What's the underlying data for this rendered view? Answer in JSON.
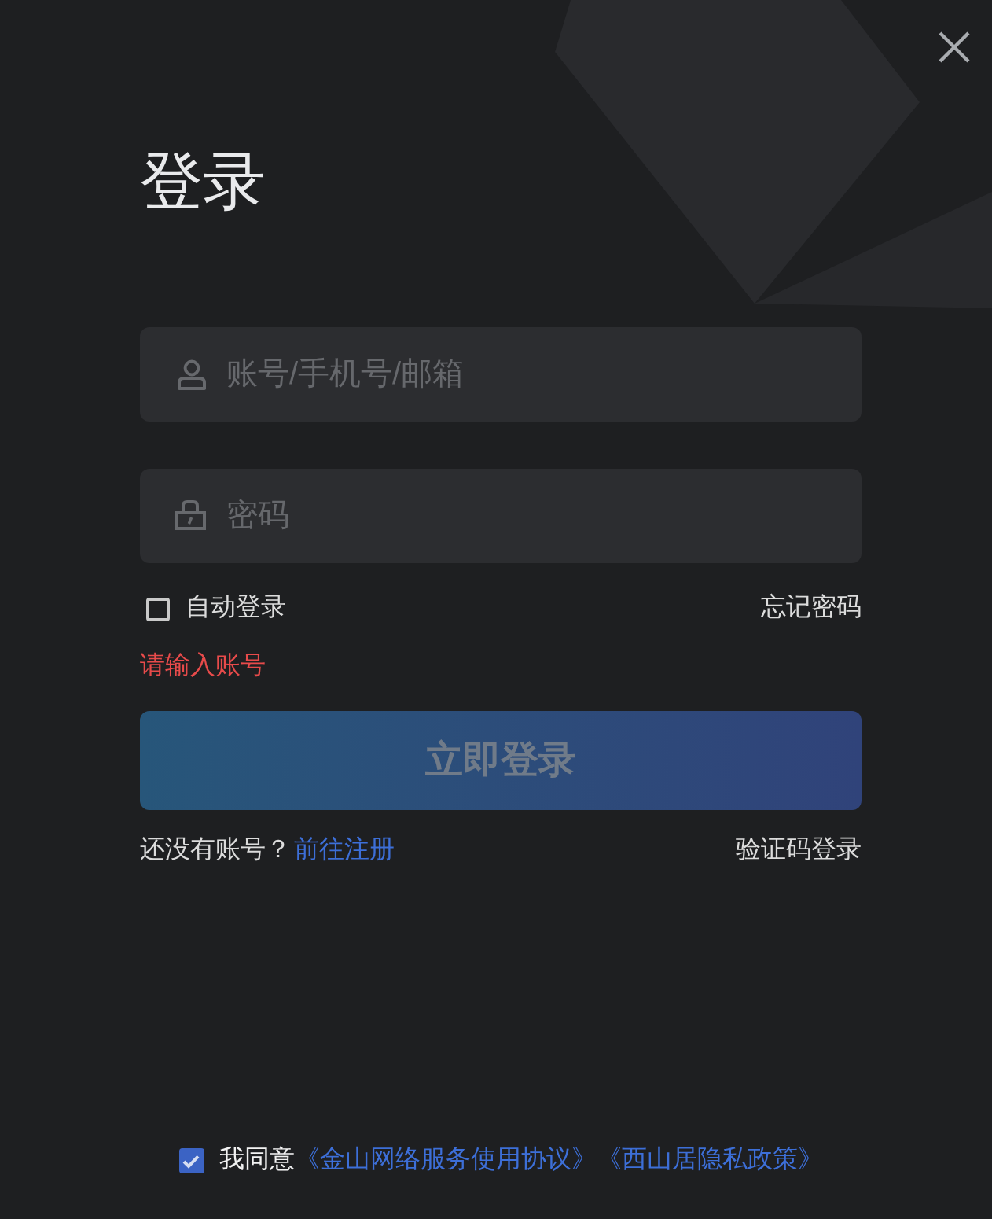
{
  "title": "登录",
  "fields": [
    {
      "kind": "account",
      "placeholder": "账号/手机号/邮箱"
    },
    {
      "kind": "password",
      "placeholder": "密码"
    }
  ],
  "auto_login": {
    "label": "自动登录",
    "checked": false
  },
  "forgot_password": "忘记密码",
  "error": "请输入账号",
  "login_button": {
    "label": "立即登录",
    "disabled": true
  },
  "register_prompt": {
    "text": "还没有账号？",
    "link": "前往注册"
  },
  "sms_login": "验证码登录",
  "agreement": {
    "checked": true,
    "text": "我同意",
    "links": [
      "《金山网络服务使用协议》",
      "《西山居隐私政策》"
    ]
  }
}
